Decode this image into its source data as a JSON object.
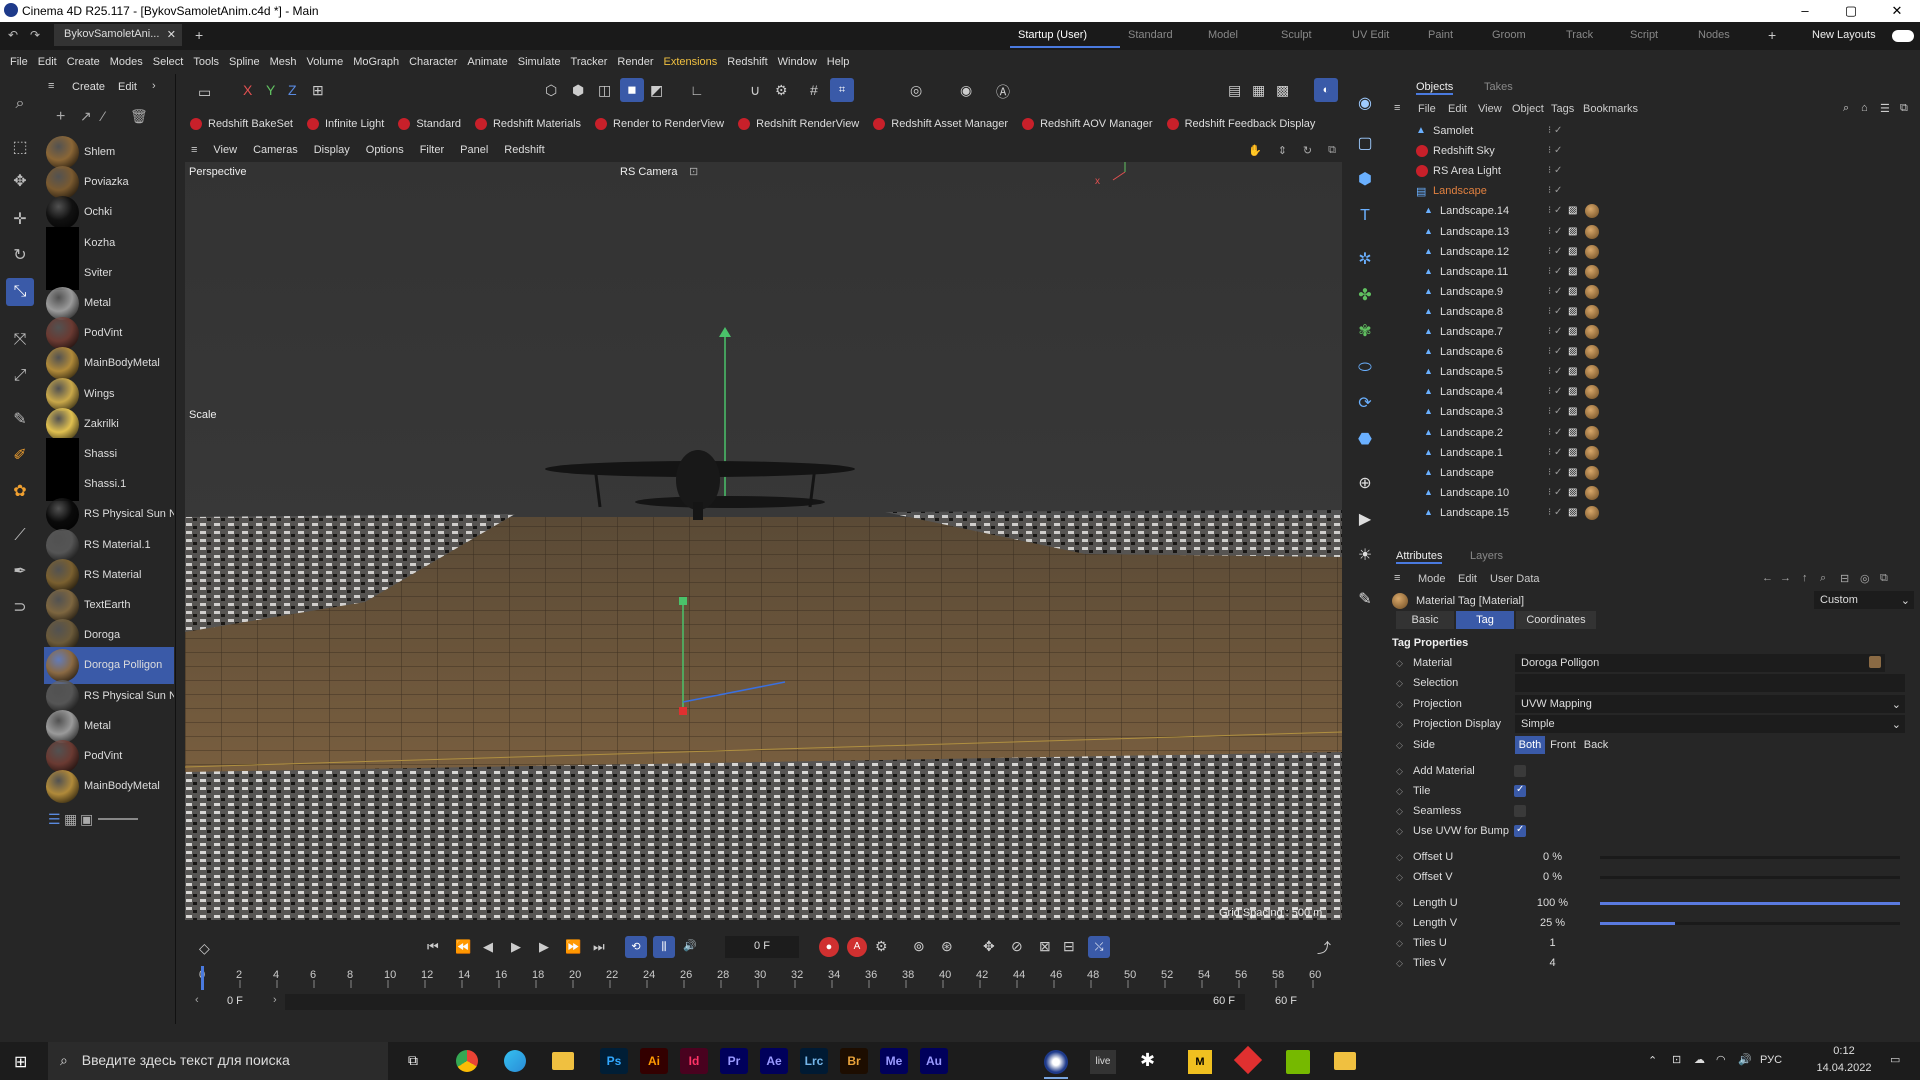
{
  "app": {
    "title": "Cinema 4D R25.117 - [BykovSamoletAnim.c4d *] - Main",
    "doc_tab": "BykovSamoletAni...",
    "win_min": "–",
    "win_max": "▢",
    "win_close": "✕"
  },
  "layouts": [
    "Startup (User)",
    "Standard",
    "Model",
    "Sculpt",
    "UV Edit",
    "Paint",
    "Groom",
    "Track",
    "Script",
    "Nodes"
  ],
  "new_layouts": "New Layouts",
  "menu": [
    "File",
    "Edit",
    "Create",
    "Modes",
    "Select",
    "Tools",
    "Spline",
    "Mesh",
    "Volume",
    "MoGraph",
    "Character",
    "Animate",
    "Simulate",
    "Tracker",
    "Render",
    "Extensions",
    "Redshift",
    "Window",
    "Help"
  ],
  "matpanel": {
    "create": "Create",
    "edit": "Edit"
  },
  "materials": [
    {
      "name": "Shlem",
      "color": "#8a6636"
    },
    {
      "name": "Poviazka",
      "color": "#7a5a30"
    },
    {
      "name": "Ochki",
      "color": "#111111"
    },
    {
      "name": "Kozha",
      "color": "#000000"
    },
    {
      "name": "Sviter",
      "color": "#000000"
    },
    {
      "name": "Metal",
      "color": "#9a9a9a"
    },
    {
      "name": "PodVint",
      "color": "#6a3a32"
    },
    {
      "name": "MainBodyMetal",
      "color": "#b08a3a"
    },
    {
      "name": "Wings",
      "color": "#c9a84a"
    },
    {
      "name": "Zakrilki",
      "color": "#e0c050"
    },
    {
      "name": "Shassi",
      "color": "#000000"
    },
    {
      "name": "Shassi.1",
      "color": "#000000"
    },
    {
      "name": "RS Physical Sun N",
      "color": "#0a0a0a"
    },
    {
      "name": "RS Material.1",
      "color": "#555555"
    },
    {
      "name": "RS Material",
      "color": "#7a6030"
    },
    {
      "name": "TextEarth",
      "color": "#7d6640"
    },
    {
      "name": "Doroga",
      "color": "#6b5a3a"
    },
    {
      "name": "Doroga Polligon",
      "color": "#8a6a44"
    },
    {
      "name": "RS Physical Sun N",
      "color": "#555555"
    },
    {
      "name": "Metal",
      "color": "#9a9a9a"
    },
    {
      "name": "PodVint",
      "color": "#6a3a32"
    },
    {
      "name": "MainBodyMetal",
      "color": "#b08a3a"
    }
  ],
  "rs_tools": [
    "Redshift BakeSet",
    "Infinite Light",
    "Standard",
    "Redshift Materials",
    "Render to RenderView",
    "Redshift RenderView",
    "Redshift Asset Manager",
    "Redshift AOV Manager",
    "Redshift Feedback Display"
  ],
  "viewport": {
    "menu": [
      "View",
      "Cameras",
      "Display",
      "Options",
      "Filter",
      "Panel",
      "Redshift"
    ],
    "name": "Perspective",
    "camera": "RS Camera",
    "scale": "Scale",
    "grid": "Grid Spacing : 500 m"
  },
  "objects": {
    "tabs": [
      "Objects",
      "Takes"
    ],
    "menu": [
      "File",
      "Edit",
      "View",
      "Object",
      "Tags",
      "Bookmarks"
    ],
    "items": [
      {
        "name": "Samolet",
        "type": "root",
        "color": "#ddd"
      },
      {
        "name": "Redshift Sky",
        "type": "rs",
        "color": "#ddd"
      },
      {
        "name": "RS Area Light",
        "type": "rs",
        "color": "#ddd"
      },
      {
        "name": "Landscape",
        "type": "group",
        "color": "#e08040"
      },
      {
        "name": "Landscape.14",
        "type": "child",
        "color": "#ddd"
      },
      {
        "name": "Landscape.13",
        "type": "child",
        "color": "#ddd"
      },
      {
        "name": "Landscape.12",
        "type": "child",
        "color": "#ddd"
      },
      {
        "name": "Landscape.11",
        "type": "child",
        "color": "#ddd"
      },
      {
        "name": "Landscape.9",
        "type": "child",
        "color": "#ddd"
      },
      {
        "name": "Landscape.8",
        "type": "child",
        "color": "#ddd"
      },
      {
        "name": "Landscape.7",
        "type": "child",
        "color": "#ddd"
      },
      {
        "name": "Landscape.6",
        "type": "child",
        "color": "#ddd"
      },
      {
        "name": "Landscape.5",
        "type": "child",
        "color": "#ddd"
      },
      {
        "name": "Landscape.4",
        "type": "child",
        "color": "#ddd"
      },
      {
        "name": "Landscape.3",
        "type": "child",
        "color": "#ddd"
      },
      {
        "name": "Landscape.2",
        "type": "child",
        "color": "#ddd"
      },
      {
        "name": "Landscape.1",
        "type": "child",
        "color": "#ddd"
      },
      {
        "name": "Landscape",
        "type": "child",
        "color": "#ddd"
      },
      {
        "name": "Landscape.10",
        "type": "child",
        "color": "#ddd"
      },
      {
        "name": "Landscape.15",
        "type": "child",
        "color": "#ddd"
      }
    ]
  },
  "attributes": {
    "tabs": [
      "Attributes",
      "Layers"
    ],
    "menu": [
      "Mode",
      "Edit",
      "User Data"
    ],
    "header": "Material Tag [Material]",
    "preset": "Custom",
    "subtabs": [
      "Basic",
      "Tag",
      "Coordinates"
    ],
    "section": "Tag Properties",
    "material_label": "Material",
    "material_value": "Doroga Polligon",
    "selection_label": "Selection",
    "projection_label": "Projection",
    "projection_value": "UVW Mapping",
    "projdisplay_label": "Projection Display",
    "projdisplay_value": "Simple",
    "side_label": "Side",
    "side_options": [
      "Both",
      "Front",
      "Back"
    ],
    "add_material": "Add Material",
    "tile": "Tile",
    "seamless": "Seamless",
    "uvw_bump": "Use UVW for Bump",
    "offset_u": "Offset U",
    "offset_u_val": "0 %",
    "offset_v": "Offset V",
    "offset_v_val": "0 %",
    "length_u": "Length U",
    "length_u_val": "100 %",
    "length_u_frac": 1.0,
    "length_v": "Length V",
    "length_v_val": "25 %",
    "length_v_frac": 0.25,
    "tiles_u": "Tiles U",
    "tiles_u_val": "1",
    "tiles_v": "Tiles V",
    "tiles_v_val": "4"
  },
  "timeline": {
    "frame": "0 F",
    "start": "0 F",
    "start2": "0 F",
    "end": "60 F",
    "end2": "60 F",
    "ticks": [
      "0",
      "2",
      "4",
      "6",
      "8",
      "10",
      "12",
      "14",
      "16",
      "18",
      "20",
      "22",
      "24",
      "26",
      "28",
      "30",
      "32",
      "34",
      "36",
      "38",
      "40",
      "42",
      "44",
      "46",
      "48",
      "50",
      "52",
      "54",
      "56",
      "58",
      "60"
    ]
  },
  "taskbar": {
    "search": "Введите здесь текст для поиска",
    "lang": "РУС",
    "time": "0:12",
    "date": "14.04.2022",
    "apps": [
      {
        "label": "Ps",
        "bg": "#001e36",
        "fg": "#31a8ff"
      },
      {
        "label": "Ai",
        "bg": "#330000",
        "fg": "#ff9a00"
      },
      {
        "label": "Id",
        "bg": "#49021f",
        "fg": "#ff3366"
      },
      {
        "label": "Pr",
        "bg": "#00005b",
        "fg": "#9999ff"
      },
      {
        "label": "Ae",
        "bg": "#00005b",
        "fg": "#9999ff"
      },
      {
        "label": "Lrc",
        "bg": "#001a33",
        "fg": "#74b5e9"
      },
      {
        "label": "Br",
        "bg": "#1d0d00",
        "fg": "#e8a23b"
      },
      {
        "label": "Me",
        "bg": "#00005b",
        "fg": "#9999ff"
      },
      {
        "label": "Au",
        "bg": "#00005b",
        "fg": "#9999ff"
      }
    ]
  }
}
